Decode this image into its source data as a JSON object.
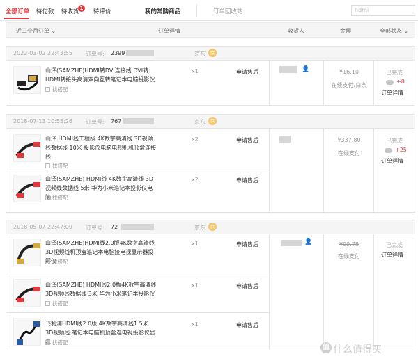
{
  "tabs": {
    "all": "全部订单",
    "pending_pay": "待付款",
    "pending_receive": "待收货",
    "pending_badge": "1",
    "pending_review": "待评价",
    "frequent": "我的常购商品",
    "recycle": "订单回收站",
    "search_placeholder": "hdmi"
  },
  "table_header": {
    "period": "近三个月订单",
    "detail": "订单详情",
    "receiver": "收货人",
    "amount": "金额",
    "status": "全部状态"
  },
  "orders": [
    {
      "date": "2022-03-02 22:43:55",
      "order_label": "订单号:",
      "order_no": "2399",
      "shop": "京东",
      "shop_icon": "京",
      "amount": "¥16.10",
      "pay": "在线支付/白条",
      "status": "已完成",
      "points": "+8",
      "detail": "订单详情",
      "items": [
        {
          "name": "山泽(SAMZHE)HDMI转DVI连接线 DVI转HDMI转接头高清双向互转笔记本电脑投影仪",
          "gift": "找搭配",
          "qty": "x1",
          "after": "申请售后"
        }
      ]
    },
    {
      "date": "2018-07-13 10:55:26",
      "order_label": "订单号:",
      "order_no": "767",
      "shop": "京东",
      "shop_icon": "京",
      "amount": "¥337.80",
      "pay": "在线支付",
      "status": "已完成",
      "points": "+25",
      "detail": "订单详情",
      "items": [
        {
          "name": "山泽 HDMI线工程级 4K数字高清线 3D视频线数据线 10米 投影仪电脑电视机机顶盒连接线",
          "gift": "找搭配",
          "qty": "x2",
          "after": "申请售后"
        },
        {
          "name": "山泽(SAMZHE) HDMI线 4K数字高清线 3D视频线数据线 5米 华为小米笔记本投影仪电脑",
          "gift": "找搭配",
          "qty": "x2",
          "after": "申请售后"
        }
      ]
    },
    {
      "date": "2018-05-07 22:47:09",
      "order_label": "订单号:",
      "order_no": "72",
      "shop": "京东",
      "shop_icon": "京",
      "amount": "¥99.78",
      "pay": "在线支付",
      "status": "已完成",
      "detail": "订单详情",
      "items": [
        {
          "name": "山泽(SAMZHE)HDMI线2.0版4K数字高清线3D视频线机顶盒笔记本电脑接电视显示器投影仪",
          "gift": "找搭配",
          "qty": "x1",
          "after": "申请售后"
        },
        {
          "name": "山泽(SAMZHE) HDMI线2.0版4K数字高清线3D视频线数据线 3米 华为小米笔记本投影仪",
          "gift": "找搭配",
          "qty": "x1",
          "after": "申请售后"
        },
        {
          "name": "飞利浦HDMI线2.0版 4K数字高清线1.5米 3D视频线 笔记本电脑机顶盒连电视投影仪显示",
          "gift": "找搭配",
          "qty": "x1",
          "after": "申请售后"
        }
      ]
    }
  ],
  "watermark": {
    "icon": "值",
    "text": "什么值得买"
  },
  "colors": {
    "accent": "#e4393c",
    "header_bg": "#f5f5f5",
    "border": "#e4e4e4"
  }
}
